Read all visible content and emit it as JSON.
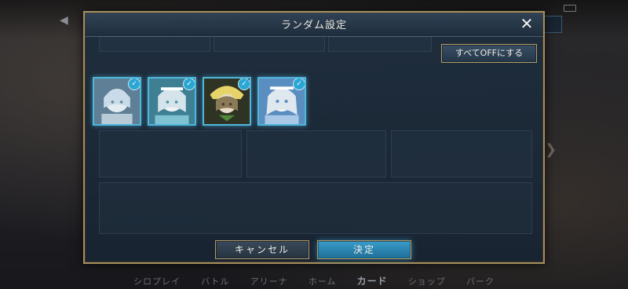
{
  "dialog": {
    "title": "ランダム設定",
    "close_icon": "close-icon",
    "all_off_label": "すべてOFFにする",
    "cards": [
      {
        "name": "card-1",
        "selected": true,
        "palette": [
          "#a7c5da",
          "#e3ecf2",
          "#6d8aa2"
        ]
      },
      {
        "name": "card-2",
        "selected": true,
        "palette": [
          "#9cc9d4",
          "#e9f1f5",
          "#58a2b8"
        ]
      },
      {
        "name": "card-3",
        "selected": true,
        "palette": [
          "#5a6a2a",
          "#e6d46a",
          "#3a3a28"
        ]
      },
      {
        "name": "card-4",
        "selected": true,
        "palette": [
          "#8ec0e0",
          "#f0f4f8",
          "#5a8ec0"
        ]
      }
    ],
    "check_icon": "✓",
    "cancel_label": "キャンセル",
    "ok_label": "決定"
  },
  "background": {
    "nav": [
      "シロプレイ",
      "バトル",
      "アリーナ",
      "ホーム",
      "カード",
      "ショップ",
      "パーク"
    ],
    "active_nav": "カード"
  }
}
